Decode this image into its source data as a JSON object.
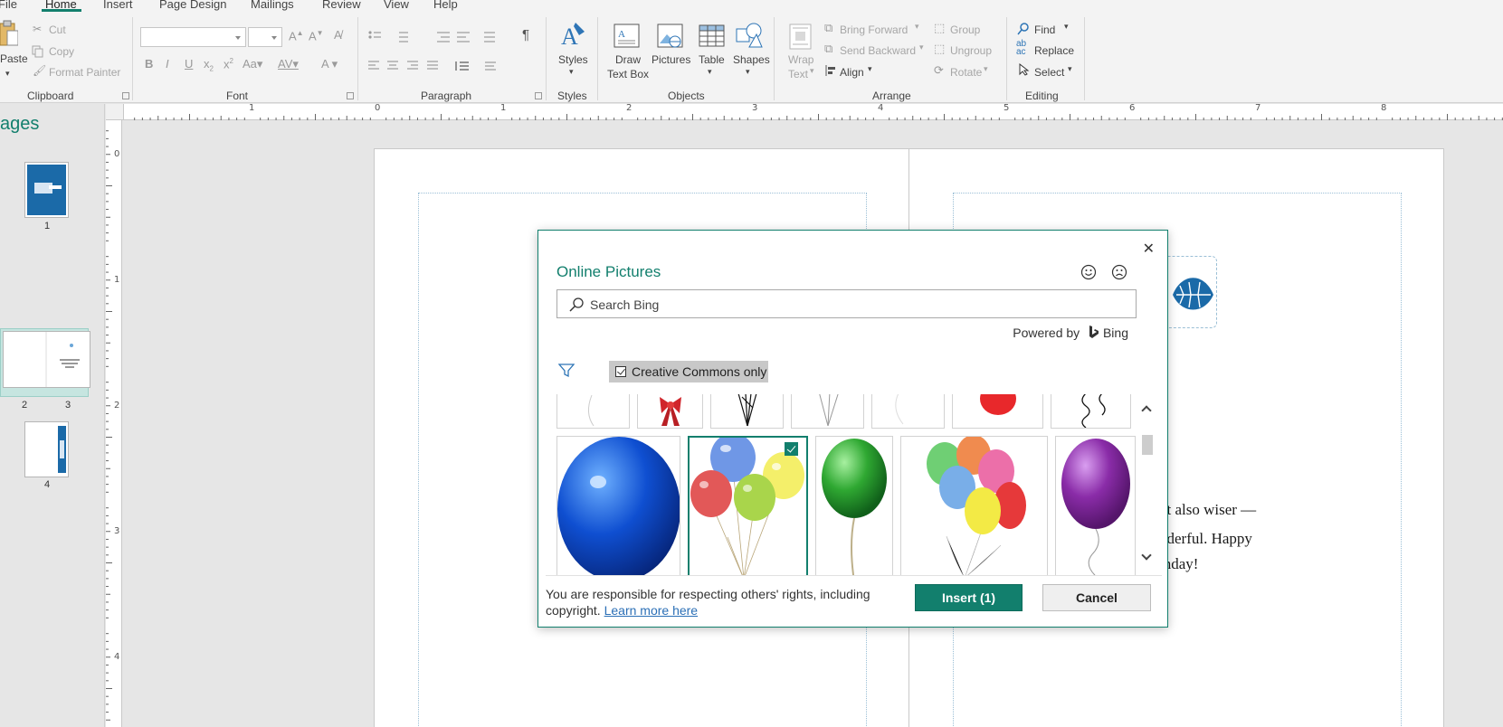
{
  "menu": {
    "file": "File",
    "home": "Home",
    "insert": "Insert",
    "page_design": "Page Design",
    "mailings": "Mailings",
    "review": "Review",
    "view": "View",
    "help": "Help"
  },
  "ribbon": {
    "clipboard": {
      "paste": "Paste",
      "cut": "Cut",
      "copy": "Copy",
      "format_painter": "Format Painter",
      "group": "Clipboard"
    },
    "font": {
      "group": "Font"
    },
    "paragraph": {
      "group": "Paragraph"
    },
    "styles": {
      "label": "Styles",
      "group": "Styles"
    },
    "objects": {
      "draw_text_box_1": "Draw",
      "draw_text_box_2": "Text Box",
      "pictures": "Pictures",
      "table": "Table",
      "shapes": "Shapes",
      "group": "Objects"
    },
    "arrange": {
      "wrap_text_1": "Wrap",
      "wrap_text_2": "Text",
      "bring_forward": "Bring Forward",
      "send_backward": "Send Backward",
      "align": "Align",
      "group_btn": "Group",
      "ungroup": "Ungroup",
      "rotate": "Rotate",
      "group": "Arrange"
    },
    "editing": {
      "find": "Find",
      "replace": "Replace",
      "select": "Select",
      "group": "Editing"
    }
  },
  "pages_pane": {
    "title": "ages",
    "thumbs": [
      {
        "num": "1"
      },
      {
        "num_left": "2",
        "num_right": "3"
      },
      {
        "num": "4"
      }
    ]
  },
  "ruler": {
    "h_labels": [
      "1",
      "0",
      "1",
      "2",
      "3",
      "4",
      "5",
      "6",
      "7",
      "8"
    ],
    "v_labels": [
      "0",
      "1",
      "2",
      "3",
      "4"
    ]
  },
  "document": {
    "line1": "ut also wiser —",
    "line2": "nderful.  Happy",
    "line3": "thday!"
  },
  "dialog": {
    "title": "Online Pictures",
    "close": "✕",
    "search_placeholder": "Search Bing",
    "powered_by": "Powered by",
    "bing": "Bing",
    "creative_commons": "Creative Commons only",
    "disclaimer": "You are responsible for respecting others' rights, including copyright.",
    "learn_more": "Learn more here",
    "insert_button": "Insert (1)",
    "cancel_button": "Cancel"
  },
  "colors": {
    "accent": "#127f6d",
    "link": "#2b6fb6"
  }
}
